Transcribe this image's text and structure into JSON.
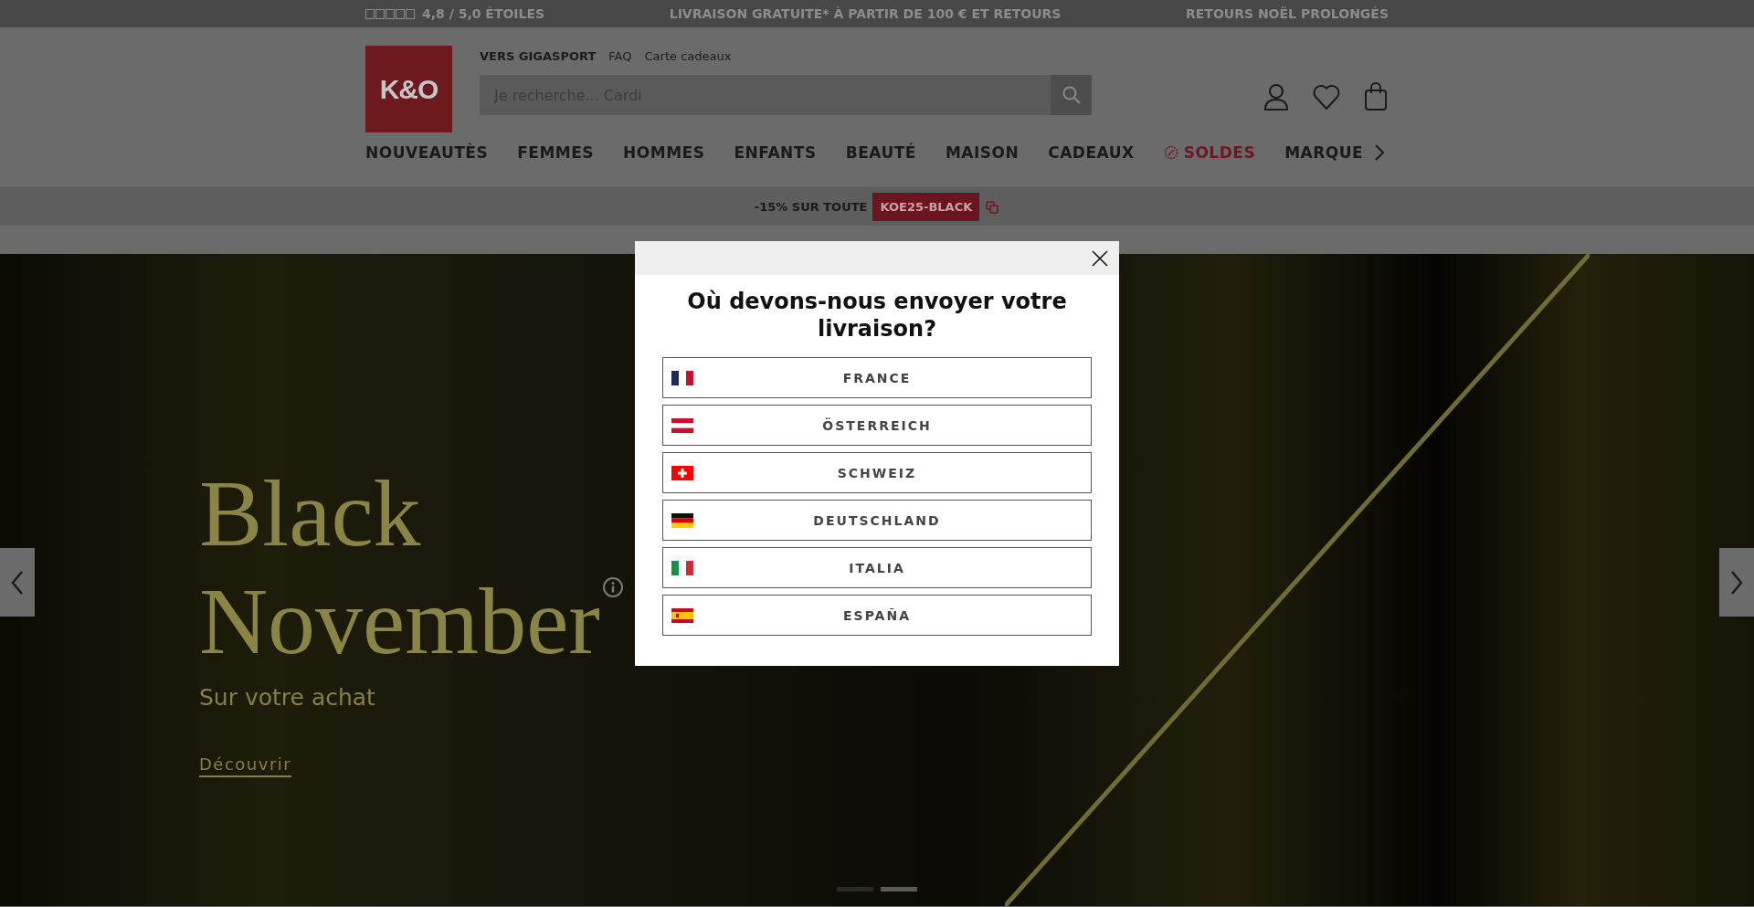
{
  "top_bar": {
    "rating": "4,8 / 5,0 ÉTOILES",
    "messages": [
      "LIVRAISON GRATUITE* À PARTIR DE 100 € ET RETOURS",
      "RETOURS NOËL PROLONGÉS"
    ]
  },
  "header": {
    "logo": "K&O",
    "links": [
      {
        "label": "VERS GIGASPORT",
        "bold": true
      },
      {
        "label": "FAQ",
        "bold": false
      },
      {
        "label": "Carte cadeaux",
        "bold": false
      }
    ],
    "search": {
      "placeholder": "Je recherche... Cardi"
    },
    "nav": [
      {
        "label": "NOUVEAUTÈS",
        "kind": "plain"
      },
      {
        "label": "FEMMES",
        "kind": "plain"
      },
      {
        "label": "HOMMES",
        "kind": "plain"
      },
      {
        "label": "ENFANTS",
        "kind": "plain"
      },
      {
        "label": "BEAUTÉ",
        "kind": "plain"
      },
      {
        "label": "MAISON",
        "kind": "plain"
      },
      {
        "label": "CADEAUX",
        "kind": "plain"
      },
      {
        "label": "SOLDES",
        "kind": "sale"
      },
      {
        "label": "MARQUE",
        "kind": "plain"
      }
    ]
  },
  "promo": {
    "text": "-15% SUR TOUTE",
    "code": "KOE25-BLACK"
  },
  "hero": {
    "title_lines": [
      "Black",
      "November"
    ],
    "subtitle": "Sur votre achat",
    "link": "Découvrir",
    "slides": [
      {
        "selected": false
      },
      {
        "selected": true
      }
    ]
  },
  "modal": {
    "title": "Où devons-nous envoyer votre livraison?",
    "countries": [
      {
        "label": "FRANCE",
        "kind": "fr"
      },
      {
        "label": "ÖSTERREICH",
        "kind": "at"
      },
      {
        "label": "SCHWEIZ",
        "kind": "ch"
      },
      {
        "label": "DEUTSCHLAND",
        "kind": "de"
      },
      {
        "label": "ITALIA",
        "kind": "it"
      },
      {
        "label": "ESPAÑA",
        "kind": "es"
      }
    ]
  }
}
